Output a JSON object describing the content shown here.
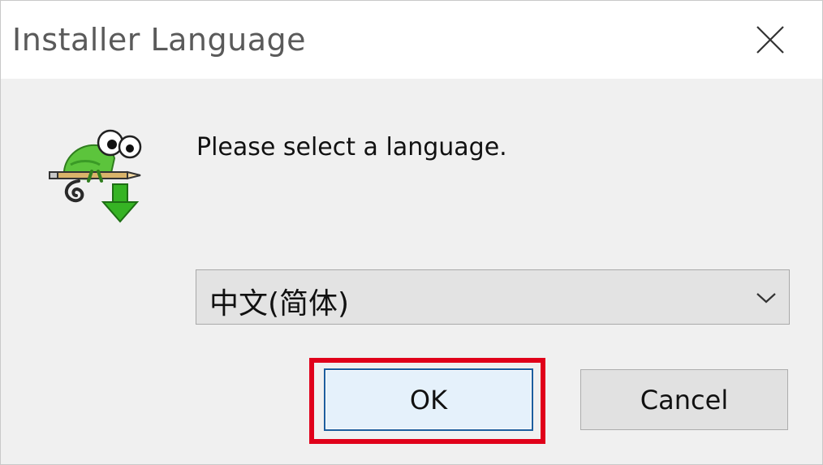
{
  "window": {
    "title": "Installer Language"
  },
  "main": {
    "prompt": "Please select a language.",
    "icon": "notepad-plus-plus-installer-icon",
    "language_select": {
      "selected": "中文(简体)"
    }
  },
  "buttons": {
    "ok_label": "OK",
    "cancel_label": "Cancel"
  },
  "colors": {
    "highlight": "#e0001a",
    "default_button_border": "#1d5e9e"
  }
}
